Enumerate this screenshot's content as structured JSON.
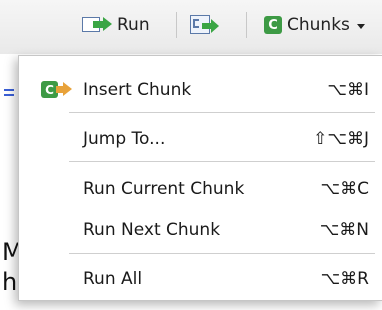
{
  "toolbar": {
    "run_label": "Run",
    "chunks_label": "Chunks",
    "chunk_icon_letter": "C",
    "icons": [
      "run-arrow-icon",
      "rerun-previous-icon",
      "chunk-icon",
      "chevron-down-icon"
    ]
  },
  "menu": {
    "items": [
      {
        "label": "Insert Chunk",
        "shortcut": "⌥⌘I",
        "icon": "insert-chunk-icon"
      },
      {
        "label": "Jump To...",
        "shortcut": "⇧⌥⌘J"
      },
      {
        "label": "Run Current Chunk",
        "shortcut": "⌥⌘C"
      },
      {
        "label": "Run Next Chunk",
        "shortcut": "⌥⌘N"
      },
      {
        "label": "Run All",
        "shortcut": "⌥⌘R"
      }
    ]
  },
  "background": {
    "letters": [
      "M",
      "h"
    ]
  },
  "colors": {
    "accent_green": "#3d9a45",
    "arrow_orange": "#e8a23a",
    "doc_blue": "#5b79a8"
  }
}
